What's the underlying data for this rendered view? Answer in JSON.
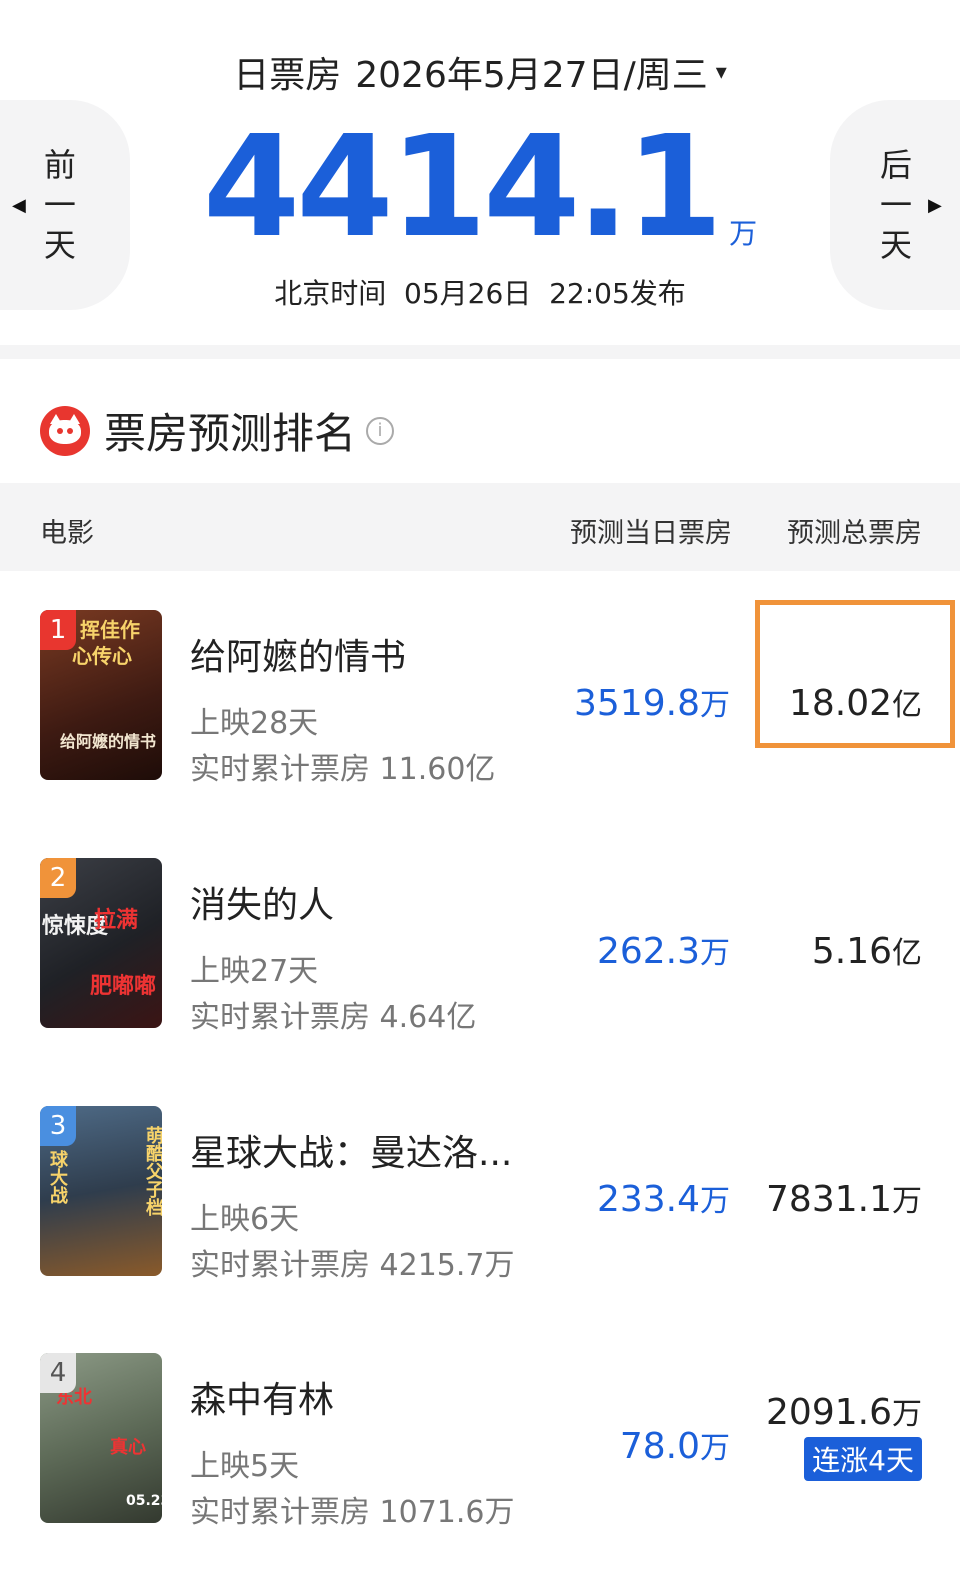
{
  "header": {
    "label": "日票房",
    "date": "2026年5月27日/周三",
    "dropdown": "▾",
    "prev_day": [
      "前",
      "一",
      "天"
    ],
    "next_day": [
      "后",
      "一",
      "天"
    ],
    "total_value": "4414.1",
    "total_unit": "万",
    "publish_info": "北京时间  05月26日  22:05发布"
  },
  "section": {
    "title": "票房预测排名",
    "info": "i"
  },
  "table": {
    "col_movie": "电影",
    "col_day": "预测当日票房",
    "col_total": "预测总票房"
  },
  "movies": [
    {
      "rank": "1",
      "name": "给阿嬷的情书",
      "days": "上映28天",
      "cumulative": "实时累计票房 11.60亿",
      "pred_day_value": "3519.8",
      "pred_day_unit": "万",
      "pred_total_value": "18.02",
      "pred_total_unit": "亿",
      "badge": "",
      "rank_color": "#e8362f",
      "poster_color": "#5a2a1e"
    },
    {
      "rank": "2",
      "name": "消失的人",
      "days": "上映27天",
      "cumulative": "实时累计票房 4.64亿",
      "pred_day_value": "262.3",
      "pred_day_unit": "万",
      "pred_total_value": "5.16",
      "pred_total_unit": "亿",
      "badge": "",
      "rank_color": "#f0933a",
      "poster_color": "#2b2d33"
    },
    {
      "rank": "3",
      "name": "星球大战：曼达洛...",
      "days": "上映6天",
      "cumulative": "实时累计票房 4215.7万",
      "pred_day_value": "233.4",
      "pred_day_unit": "万",
      "pred_total_value": "7831.1",
      "pred_total_unit": "万",
      "badge": "",
      "rank_color": "#4a8fe0",
      "poster_color": "#3a4b5e"
    },
    {
      "rank": "4",
      "name": "森中有林",
      "days": "上映5天",
      "cumulative": "实时累计票房 1071.6万",
      "pred_day_value": "78.0",
      "pred_day_unit": "万",
      "pred_total_value": "2091.6",
      "pred_total_unit": "万",
      "badge": "连涨4天",
      "rank_color": "#9aa0a6",
      "poster_color": "#6f7d6a"
    }
  ]
}
